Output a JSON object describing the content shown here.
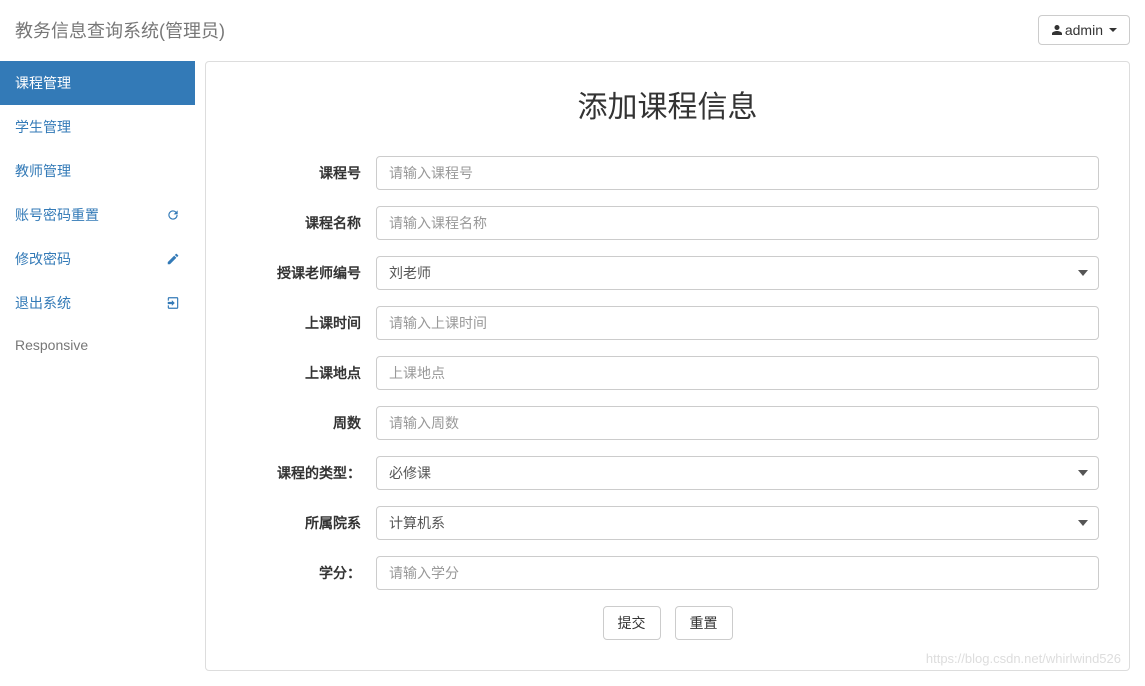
{
  "navbar": {
    "brand": "教务信息查询系统(管理员)",
    "user": "admin"
  },
  "sidebar": {
    "items": [
      {
        "label": "课程管理",
        "icon": "",
        "active": true
      },
      {
        "label": "学生管理",
        "icon": "",
        "active": false
      },
      {
        "label": "教师管理",
        "icon": "",
        "active": false
      },
      {
        "label": "账号密码重置",
        "icon": "refresh",
        "active": false
      },
      {
        "label": "修改密码",
        "icon": "pencil",
        "active": false
      },
      {
        "label": "退出系统",
        "icon": "logout",
        "active": false
      }
    ],
    "footer_text": "Responsive"
  },
  "page": {
    "title": "添加课程信息",
    "watermark": "https://blog.csdn.net/whirlwind526"
  },
  "form": {
    "course_id": {
      "label": "课程号",
      "placeholder": "请输入课程号",
      "value": ""
    },
    "course_name": {
      "label": "课程名称",
      "placeholder": "请输入课程名称",
      "value": ""
    },
    "teacher_id": {
      "label": "授课老师编号",
      "selected": "刘老师"
    },
    "class_time": {
      "label": "上课时间",
      "placeholder": "请输入上课时间",
      "value": ""
    },
    "location": {
      "label": "上课地点",
      "placeholder": "上课地点",
      "value": ""
    },
    "weeks": {
      "label": "周数",
      "placeholder": "请输入周数",
      "value": ""
    },
    "course_type": {
      "label": "课程的类型：",
      "selected": "必修课"
    },
    "department": {
      "label": "所属院系",
      "selected": "计算机系"
    },
    "credit": {
      "label": "学分：",
      "placeholder": "请输入学分",
      "value": ""
    },
    "submit_label": "提交",
    "reset_label": "重置"
  }
}
